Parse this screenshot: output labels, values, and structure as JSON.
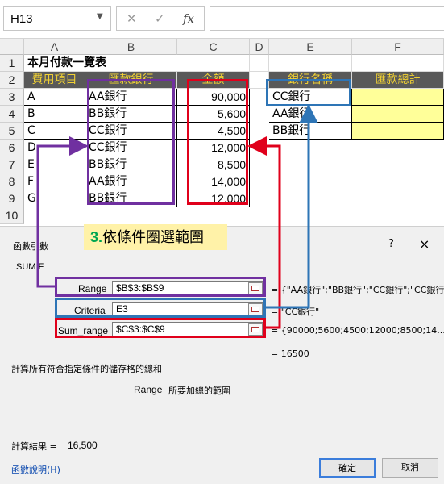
{
  "formula_bar": {
    "name_box": "H13",
    "cancel_icon": "✕",
    "enter_icon": "✓",
    "fx_label": "fx",
    "formula": ""
  },
  "sheet": {
    "columns": [
      "A",
      "B",
      "C",
      "D",
      "E",
      "F"
    ],
    "rows": [
      "1",
      "2",
      "3",
      "4",
      "5",
      "6",
      "7",
      "8",
      "9",
      "10"
    ],
    "title": "本月付款一覽表",
    "table1_headers": [
      "費用項目",
      "匯款銀行",
      "金額"
    ],
    "table1_rows": [
      [
        "A",
        "AA銀行",
        "90,000"
      ],
      [
        "B",
        "BB銀行",
        "5,600"
      ],
      [
        "C",
        "CC銀行",
        "4,500"
      ],
      [
        "D",
        "CC銀行",
        "12,000"
      ],
      [
        "E",
        "BB銀行",
        "8,500"
      ],
      [
        "F",
        "AA銀行",
        "14,000"
      ],
      [
        "G",
        "BB銀行",
        "12,000"
      ]
    ],
    "table2_headers": [
      "銀行名稱",
      "匯款總計"
    ],
    "table2_rows": [
      [
        "CC銀行",
        ""
      ],
      [
        "AA銀行",
        ""
      ],
      [
        "BB銀行",
        ""
      ]
    ],
    "annotation": "3.依條件圈選範圍",
    "annotation_number": "3.",
    "annotation_text": "依條件圈選範圍"
  },
  "dialog": {
    "title": "函數引數",
    "help_icon": "?",
    "close_icon": "×",
    "function_name": "SUMIF",
    "args": [
      {
        "label": "Range",
        "value": "$B$3:$B$9",
        "result": "= {\"AA銀行\";\"BB銀行\";\"CC銀行\";\"CC銀行"
      },
      {
        "label": "Criteria",
        "value": "E3",
        "result": "= \"CC銀行\""
      },
      {
        "label": "Sum_range",
        "value": "$C$3:$C$9",
        "result": "= {90000;5600;4500;12000;8500;14..."
      }
    ],
    "func_result": "= 16500",
    "description": "計算所有符合指定條件的儲存格的總和",
    "arg_desc_name": "Range",
    "arg_desc_text": "所要加總的範圍",
    "result_label": "計算結果 =",
    "result_value": "16,500",
    "help_link": "函數說明(H)",
    "ok_label": "確定",
    "cancel_label": "取消"
  },
  "colors": {
    "purple": "#7030a0",
    "blue": "#2e75b6",
    "red": "#e0001b",
    "header_bg": "#595959",
    "header_text": "#f2d233",
    "highlight_yellow": "#ffff99",
    "annotation_bg": "#fff2a8",
    "annotation_number": "#00a651"
  }
}
